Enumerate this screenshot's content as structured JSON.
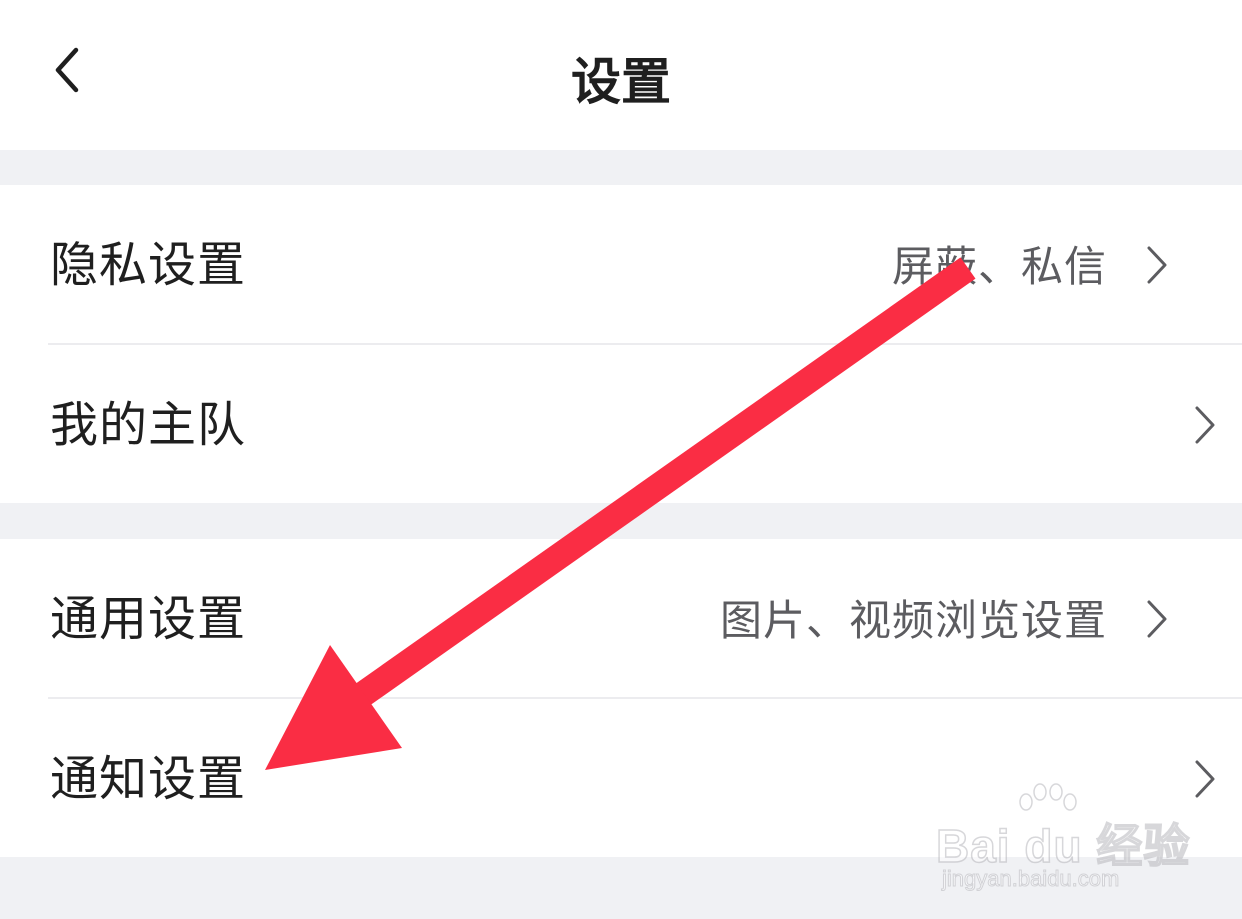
{
  "header": {
    "title": "设置",
    "back_icon": "chevron-left-icon"
  },
  "settings_groups": [
    {
      "rows": [
        {
          "label": "隐私设置",
          "value": "屏蔽、私信"
        },
        {
          "label": "我的主队",
          "value": ""
        }
      ]
    },
    {
      "rows": [
        {
          "label": "通用设置",
          "value": "图片、视频浏览设置"
        },
        {
          "label": "通知设置",
          "value": ""
        }
      ]
    }
  ],
  "annotation": {
    "type": "arrow",
    "color": "#fa2d44",
    "points_to": "通知设置"
  },
  "watermark": {
    "brand": "Bai du 经验",
    "url": "jingyan.baidu.com"
  },
  "colors": {
    "background": "#f0f1f4",
    "surface": "#ffffff",
    "text_primary": "#1f1f1f",
    "text_secondary": "#5c5c60",
    "divider": "#ececef"
  }
}
